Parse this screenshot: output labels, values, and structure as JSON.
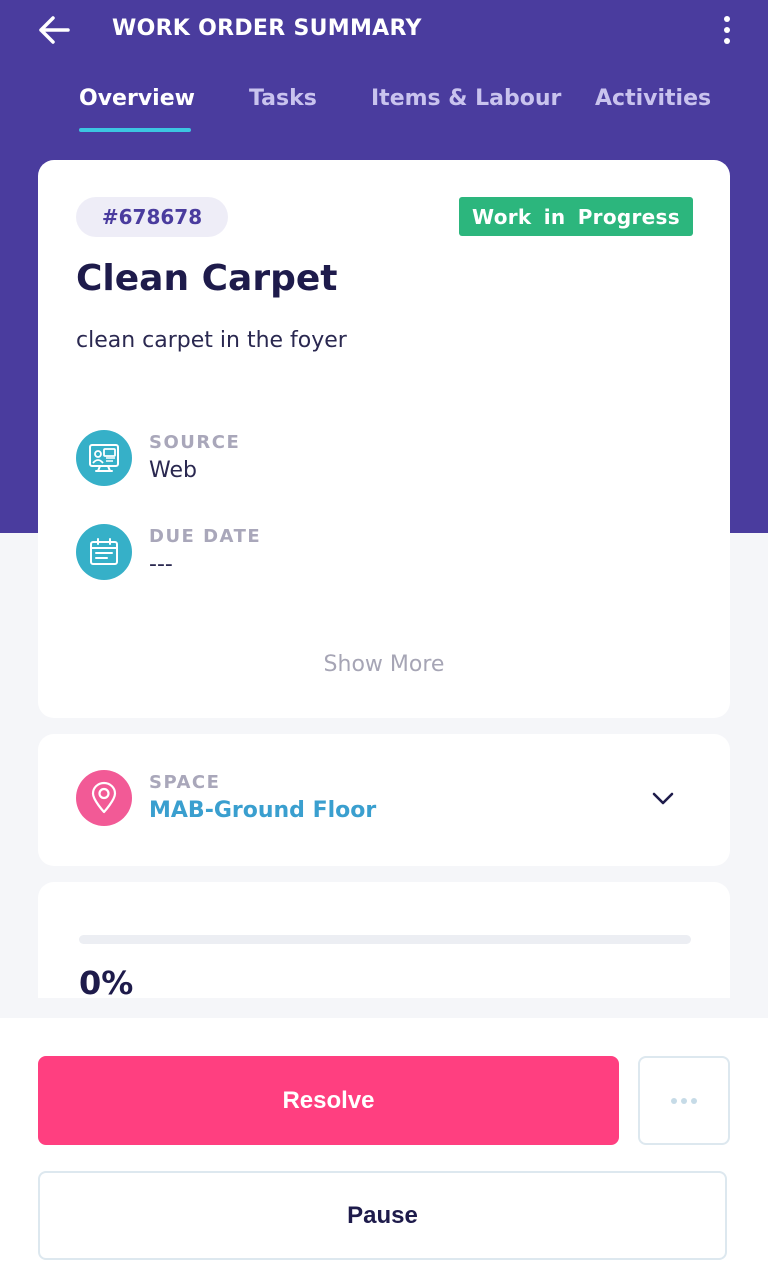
{
  "header": {
    "title": "WORK ORDER SUMMARY",
    "back_icon": "arrow-left-icon",
    "menu_icon": "more-vertical-icon"
  },
  "tabs": [
    {
      "label": "Overview",
      "active": true
    },
    {
      "label": "Tasks",
      "active": false
    },
    {
      "label": "Items & Labour",
      "active": false
    },
    {
      "label": "Activities",
      "active": false
    }
  ],
  "work_order": {
    "id": "#678678",
    "status": "Work in Progress",
    "title": "Clean Carpet",
    "description": "clean carpet in the foyer",
    "fields": [
      {
        "label": "SOURCE",
        "value": "Web",
        "icon": "web-source-icon"
      },
      {
        "label": "DUE DATE",
        "value": "---",
        "icon": "calendar-icon"
      }
    ],
    "show_more": "Show More"
  },
  "space": {
    "label": "SPACE",
    "value": "MAB-Ground Floor",
    "icon": "location-pin-icon"
  },
  "progress": {
    "percent": 0,
    "label": "0%"
  },
  "actions": {
    "resolve": "Resolve",
    "pause": "Pause"
  },
  "colors": {
    "header": "#4a3c9e",
    "status_badge": "#2cb67d",
    "resolve_button": "#ff3f80",
    "accent": "#3cc6e2",
    "space_link": "#3a9fcf"
  }
}
